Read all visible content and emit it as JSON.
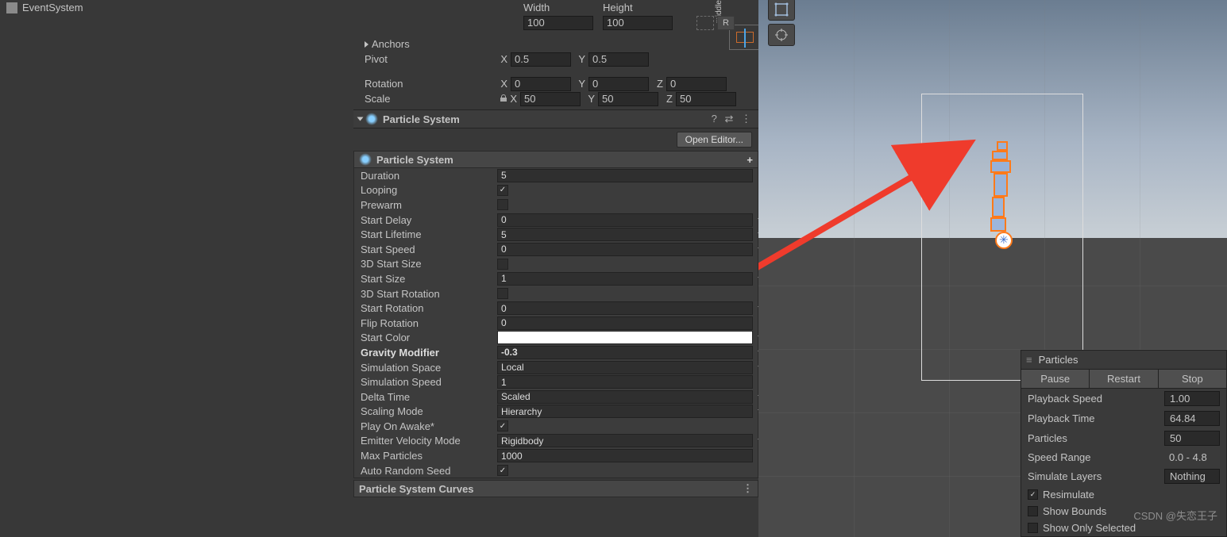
{
  "hierarchy": {
    "eventsystem": "EventSystem"
  },
  "rect": {
    "anchor_label_side": "middle",
    "width_label": "Width",
    "height_label": "Height",
    "width": "100",
    "height": "100",
    "anchors": "Anchors",
    "pivot": "Pivot",
    "pivot_x": "0.5",
    "pivot_y": "0.5",
    "rotation": "Rotation",
    "rot_x": "0",
    "rot_y": "0",
    "rot_z": "0",
    "scale": "Scale",
    "scale_x": "50",
    "scale_y": "50",
    "scale_z": "50",
    "X": "X",
    "Y": "Y",
    "Z": "Z",
    "R": "R"
  },
  "component": {
    "title": "Particle System",
    "open_editor": "Open Editor...",
    "module_title": "Particle System"
  },
  "ps": {
    "duration_l": "Duration",
    "duration_v": "5",
    "looping_l": "Looping",
    "looping_v": true,
    "prewarm_l": "Prewarm",
    "prewarm_v": false,
    "startdelay_l": "Start Delay",
    "startdelay_v": "0",
    "startlife_l": "Start Lifetime",
    "startlife_v": "5",
    "startspeed_l": "Start Speed",
    "startspeed_v": "0",
    "size3d_l": "3D Start Size",
    "size3d_v": false,
    "startsize_l": "Start Size",
    "startsize_v": "1",
    "rot3d_l": "3D Start Rotation",
    "rot3d_v": false,
    "startrot_l": "Start Rotation",
    "startrot_v": "0",
    "fliprot_l": "Flip Rotation",
    "fliprot_v": "0",
    "startcolor_l": "Start Color",
    "gravity_l": "Gravity Modifier",
    "gravity_v": "-0.3",
    "simspace_l": "Simulation Space",
    "simspace_v": "Local",
    "simspeed_l": "Simulation Speed",
    "simspeed_v": "1",
    "deltatime_l": "Delta Time",
    "deltatime_v": "Scaled",
    "scalemode_l": "Scaling Mode",
    "scalemode_v": "Hierarchy",
    "playawake_l": "Play On Awake*",
    "playawake_v": true,
    "emitvel_l": "Emitter Velocity Mode",
    "emitvel_v": "Rigidbody",
    "maxpart_l": "Max Particles",
    "maxpart_v": "1000",
    "autoseed_l": "Auto Random Seed",
    "autoseed_v": true,
    "curves": "Particle System Curves"
  },
  "pp": {
    "title": "Particles",
    "pause": "Pause",
    "restart": "Restart",
    "stop": "Stop",
    "pbspd_k": "Playback Speed",
    "pbspd_v": "1.00",
    "pbtime_k": "Playback Time",
    "pbtime_v": "64.84",
    "parts_k": "Particles",
    "parts_v": "50",
    "spdrng_k": "Speed Range",
    "spdrng_v": "0.0 - 4.8",
    "simlay_k": "Simulate Layers",
    "simlay_v": "Nothing",
    "resim": "Resimulate",
    "resim_v": true,
    "bounds": "Show Bounds",
    "bounds_v": false,
    "only": "Show Only Selected",
    "only_v": false
  },
  "watermark": "CSDN @失恋王子"
}
